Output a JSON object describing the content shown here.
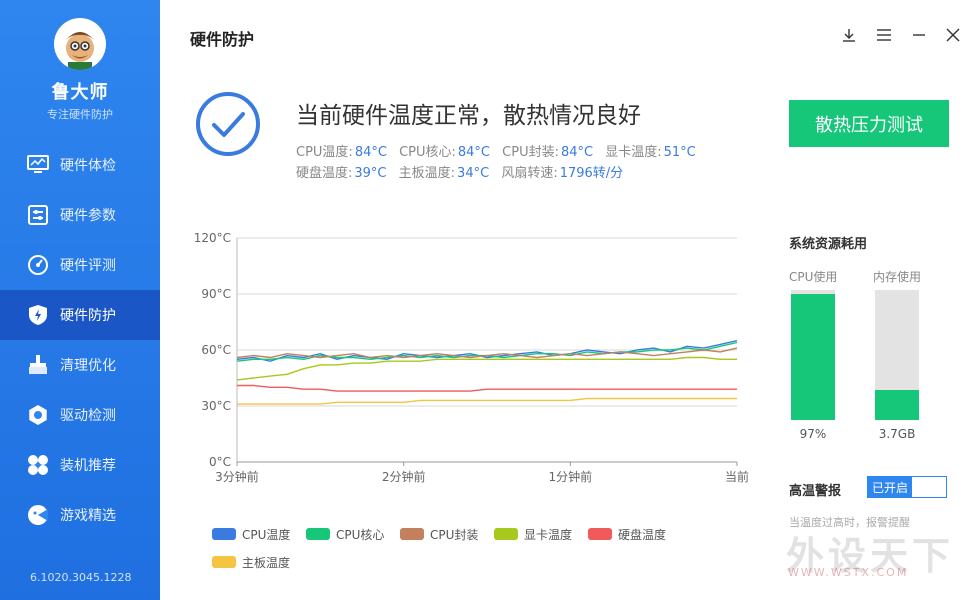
{
  "app": {
    "name": "鲁大师",
    "subtitle": "专注硬件防护",
    "version": "6.1020.3045.1228"
  },
  "nav": [
    {
      "label": "硬件体检",
      "icon": "monitor-icon",
      "active": false
    },
    {
      "label": "硬件参数",
      "icon": "sliders-icon",
      "active": false
    },
    {
      "label": "硬件评测",
      "icon": "gauge-icon",
      "active": false
    },
    {
      "label": "硬件防护",
      "icon": "shield-icon",
      "active": true
    },
    {
      "label": "清理优化",
      "icon": "broom-icon",
      "active": false
    },
    {
      "label": "驱动检测",
      "icon": "gear-icon",
      "active": false
    },
    {
      "label": "装机推荐",
      "icon": "fan-icon",
      "active": false
    },
    {
      "label": "游戏精选",
      "icon": "gamepad-icon",
      "active": false
    }
  ],
  "header": {
    "title": "硬件防护",
    "controls": [
      "download-icon",
      "menu-icon",
      "minimize-icon",
      "close-icon"
    ]
  },
  "status": {
    "headline": "当前硬件温度正常，散热情况良好",
    "row1": [
      {
        "label": "CPU温度:",
        "value": "84°C"
      },
      {
        "label": "CPU核心:",
        "value": "84°C"
      },
      {
        "label": "CPU封装:",
        "value": "84°C"
      },
      {
        "label": "显卡温度:",
        "value": "51°C"
      }
    ],
    "row2": [
      {
        "label": "硬盘温度:",
        "value": "39°C"
      },
      {
        "label": "主板温度:",
        "value": "34°C"
      },
      {
        "label": "风扇转速:",
        "value": "1796转/分"
      }
    ],
    "test_button": "散热压力测试"
  },
  "chart_data": {
    "type": "line",
    "y_ticks": [
      "120°C",
      "90°C",
      "60°C",
      "30°C",
      "0°C"
    ],
    "ylim": [
      0,
      120
    ],
    "x_ticks": [
      "3分钟前",
      "2分钟前",
      "1分钟前",
      "当前"
    ],
    "grid": true,
    "series": [
      {
        "name": "CPU温度",
        "color": "#3a7be0",
        "values": [
          55,
          56,
          54,
          57,
          56,
          58,
          55,
          57,
          56,
          55,
          58,
          57,
          56,
          57,
          58,
          56,
          57,
          58,
          59,
          57,
          58,
          60,
          59,
          58,
          60,
          61,
          59,
          62,
          61,
          63,
          65
        ]
      },
      {
        "name": "CPU核心",
        "color": "#16c77a",
        "values": [
          54,
          55,
          55,
          56,
          55,
          57,
          56,
          56,
          55,
          56,
          57,
          56,
          57,
          56,
          57,
          57,
          56,
          57,
          58,
          58,
          57,
          59,
          58,
          59,
          59,
          60,
          60,
          61,
          60,
          62,
          64
        ]
      },
      {
        "name": "CPU封装",
        "color": "#c47f5e",
        "values": [
          56,
          57,
          56,
          58,
          57,
          56,
          57,
          58,
          56,
          57,
          56,
          57,
          58,
          57,
          56,
          57,
          58,
          57,
          56,
          57,
          58,
          57,
          58,
          59,
          58,
          57,
          58,
          59,
          60,
          59,
          61
        ]
      },
      {
        "name": "显卡温度",
        "color": "#a8c81e",
        "values": [
          44,
          45,
          46,
          47,
          50,
          52,
          52,
          53,
          53,
          54,
          54,
          54,
          55,
          55,
          55,
          55,
          55,
          55,
          55,
          55,
          55,
          55,
          55,
          55,
          55,
          55,
          55,
          56,
          56,
          55,
          55
        ]
      },
      {
        "name": "硬盘温度",
        "color": "#f05a5a",
        "values": [
          41,
          41,
          40,
          40,
          39,
          39,
          38,
          38,
          38,
          38,
          38,
          38,
          38,
          38,
          38,
          39,
          39,
          39,
          39,
          39,
          39,
          39,
          39,
          39,
          39,
          39,
          39,
          39,
          39,
          39,
          39
        ]
      },
      {
        "name": "主板温度",
        "color": "#f5c443",
        "values": [
          31,
          31,
          31,
          31,
          31,
          31,
          32,
          32,
          32,
          32,
          32,
          33,
          33,
          33,
          33,
          33,
          33,
          33,
          33,
          33,
          33,
          34,
          34,
          34,
          34,
          34,
          34,
          34,
          34,
          34,
          34
        ]
      }
    ]
  },
  "resources": {
    "title": "系统资源耗用",
    "cpu": {
      "label": "CPU使用",
      "value": "97%",
      "fraction": 0.97
    },
    "mem": {
      "label": "内存使用",
      "value": "3.7GB",
      "fraction": 0.23
    }
  },
  "alarm": {
    "label": "高温警报",
    "toggle_on": "已开启",
    "desc": "当温度过高时，报警提醒"
  },
  "watermark": {
    "text": "外设天下",
    "url": "WWW.WSTX.COM"
  }
}
